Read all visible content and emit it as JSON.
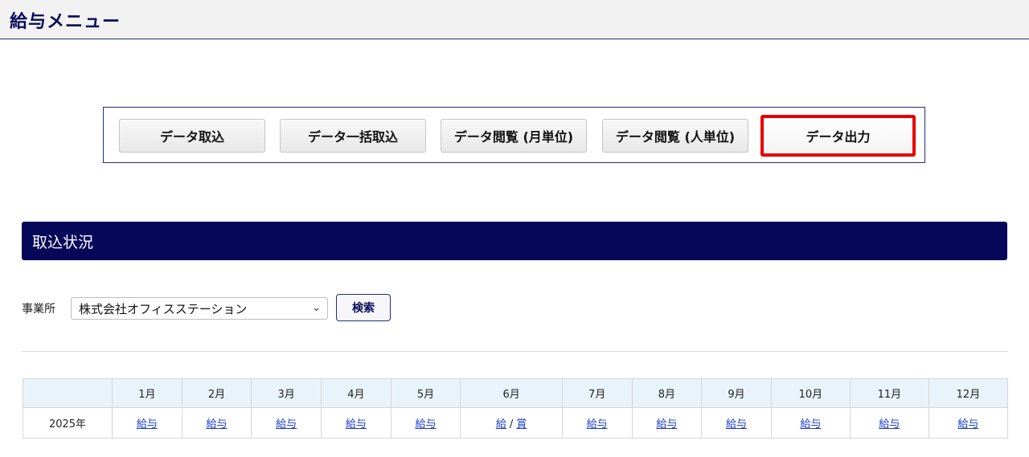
{
  "header": {
    "title": "給与メニュー"
  },
  "menu": {
    "buttons": [
      {
        "label": "データ取込"
      },
      {
        "label": "データ一括取込"
      },
      {
        "label": "データ閲覧 (月単位)"
      },
      {
        "label": "データ閲覧 (人単位)"
      },
      {
        "label": "データ出力"
      }
    ],
    "highlight_color": "#e60000"
  },
  "section": {
    "title": "取込状況",
    "color": "#07075a"
  },
  "filter": {
    "office_label": "事業所",
    "office_value": "株式会社オフィスステーション",
    "search_label": "検索"
  },
  "table": {
    "months": [
      "1月",
      "2月",
      "3月",
      "4月",
      "5月",
      "6月",
      "7月",
      "8月",
      "9月",
      "10月",
      "11月",
      "12月"
    ],
    "year": "2025年",
    "cells": [
      "給与",
      "給与",
      "給与",
      "給与",
      "給与",
      "給",
      "給与",
      "給与",
      "給与",
      "給与",
      "給与",
      "給与"
    ],
    "june_slash": "/",
    "june_bonus": "賞"
  }
}
